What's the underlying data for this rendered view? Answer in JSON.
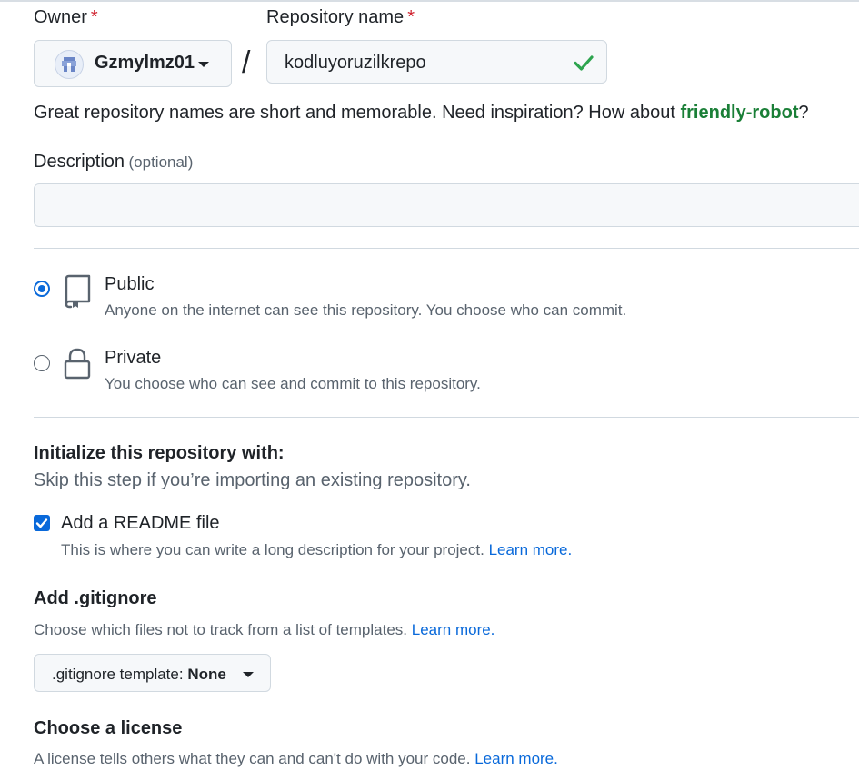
{
  "form": {
    "owner_label": "Owner",
    "owner_required": "*",
    "owner_value": "Gzmylmz01",
    "slash": "/",
    "repo_label": "Repository name",
    "repo_required": "*",
    "repo_value": "kodluyoruzilkrepo",
    "hint_text": "Great repository names are short and memorable. Need inspiration? How about ",
    "hint_suggestion": "friendly-robot",
    "hint_end": "?",
    "description_label": "Description",
    "description_optional": "(optional)",
    "description_value": ""
  },
  "visibility": {
    "selected": "public",
    "public": {
      "title": "Public",
      "desc": "Anyone on the internet can see this repository. You choose who can commit."
    },
    "private": {
      "title": "Private",
      "desc": "You choose who can see and commit to this repository."
    }
  },
  "initialize": {
    "title": "Initialize this repository with:",
    "subtitle": "Skip this step if you’re importing an existing repository.",
    "readme_label": "Add a README file",
    "readme_checked": true,
    "readme_desc": "This is where you can write a long description for your project.",
    "readme_link": "Learn more."
  },
  "gitignore": {
    "title": "Add .gitignore",
    "desc": "Choose which files not to track from a list of templates.",
    "link": "Learn more.",
    "select_prefix": ".gitignore template:",
    "select_value": "None"
  },
  "license": {
    "title": "Choose a license",
    "desc": "A license tells others what they can and can't do with your code.",
    "link": "Learn more."
  },
  "colors": {
    "accent_blue": "#0969da",
    "success_green": "#1a7f37",
    "required_red": "#cf222e"
  },
  "icons": [
    "avatar-icon",
    "caret-down-icon",
    "check-icon",
    "repo-icon",
    "lock-icon",
    "checkmark-icon"
  ]
}
